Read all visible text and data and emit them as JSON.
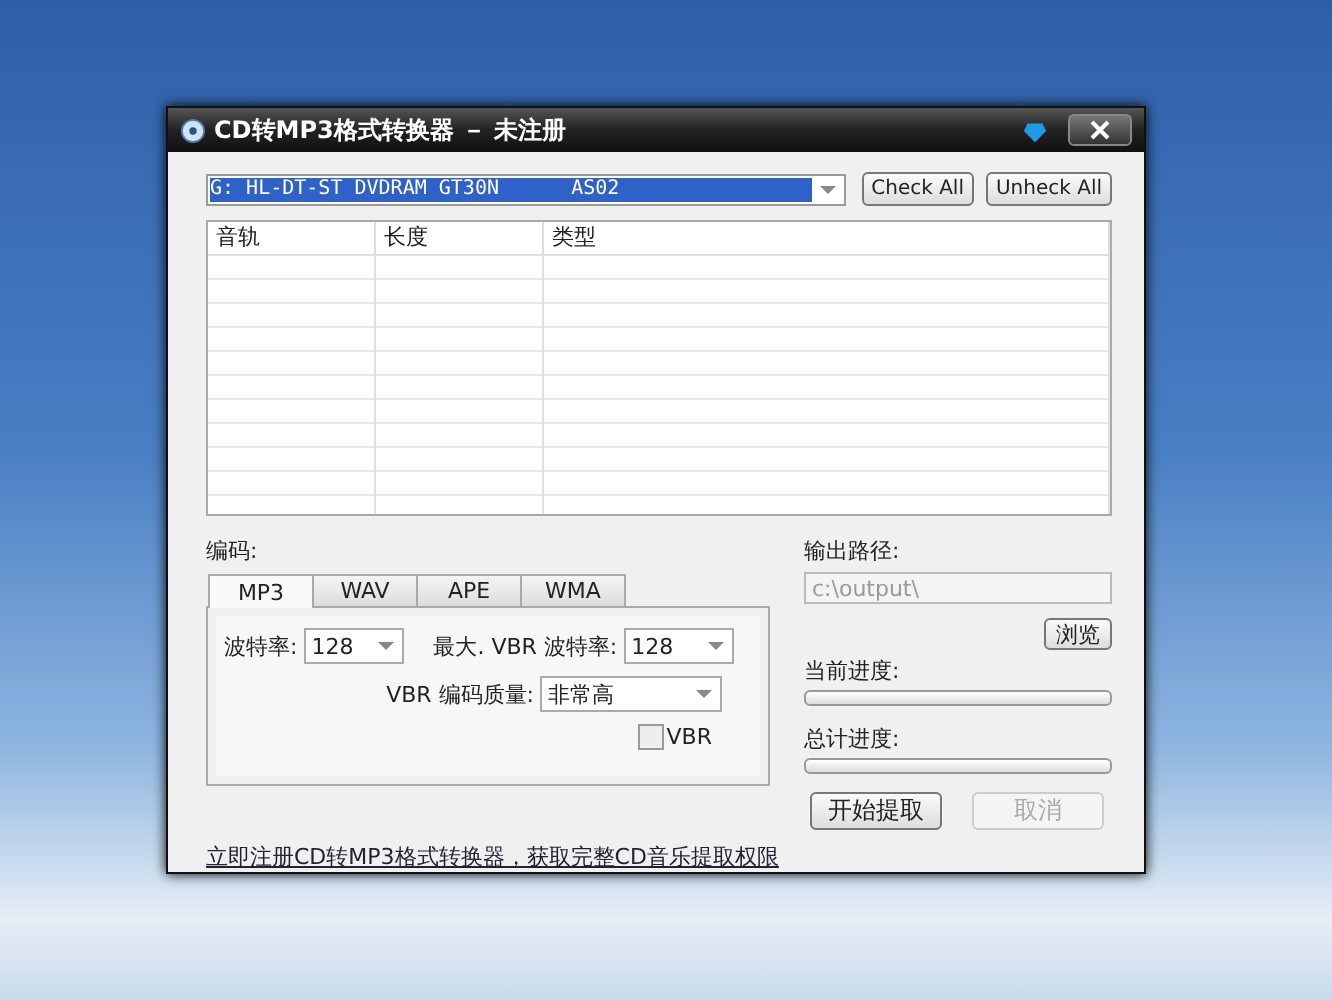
{
  "window": {
    "title": "CD转MP3格式转换器 － 未注册"
  },
  "drive": {
    "value": "G: HL-DT-ST DVDRAM GT30N      AS02"
  },
  "top_buttons": [
    "Check All",
    "Unheck All"
  ],
  "table": {
    "columns": [
      "音轨",
      "长度",
      "类型"
    ]
  },
  "encoding": {
    "label": "编码:",
    "tabs": [
      {
        "label": "MP3",
        "selected": true
      },
      {
        "label": "WAV",
        "selected": false
      },
      {
        "label": "APE",
        "selected": false
      },
      {
        "label": "WMA",
        "selected": false
      }
    ],
    "bitrate": {
      "label": "波特率:",
      "value": "128"
    },
    "max_vbr": {
      "label": "最大. VBR 波特率:",
      "value": "128"
    },
    "vbr_quality": {
      "label": "VBR 编码质量:",
      "value": "非常高"
    },
    "vbr": {
      "label": "VBR",
      "checked": false
    }
  },
  "output": {
    "label": "输出路径:",
    "value": "c:\\output\\",
    "disabled": true,
    "browse": "浏览"
  },
  "progress": [
    {
      "label": "当前进度:",
      "level": 0
    },
    {
      "label": "总计进度:",
      "level": 0
    }
  ],
  "actions": [
    {
      "label": "开始提取",
      "disabled": false
    },
    {
      "label": "取消",
      "disabled": true
    }
  ],
  "register_link": "立即注册CD转MP3格式转换器，获取完整CD音乐提取权限"
}
